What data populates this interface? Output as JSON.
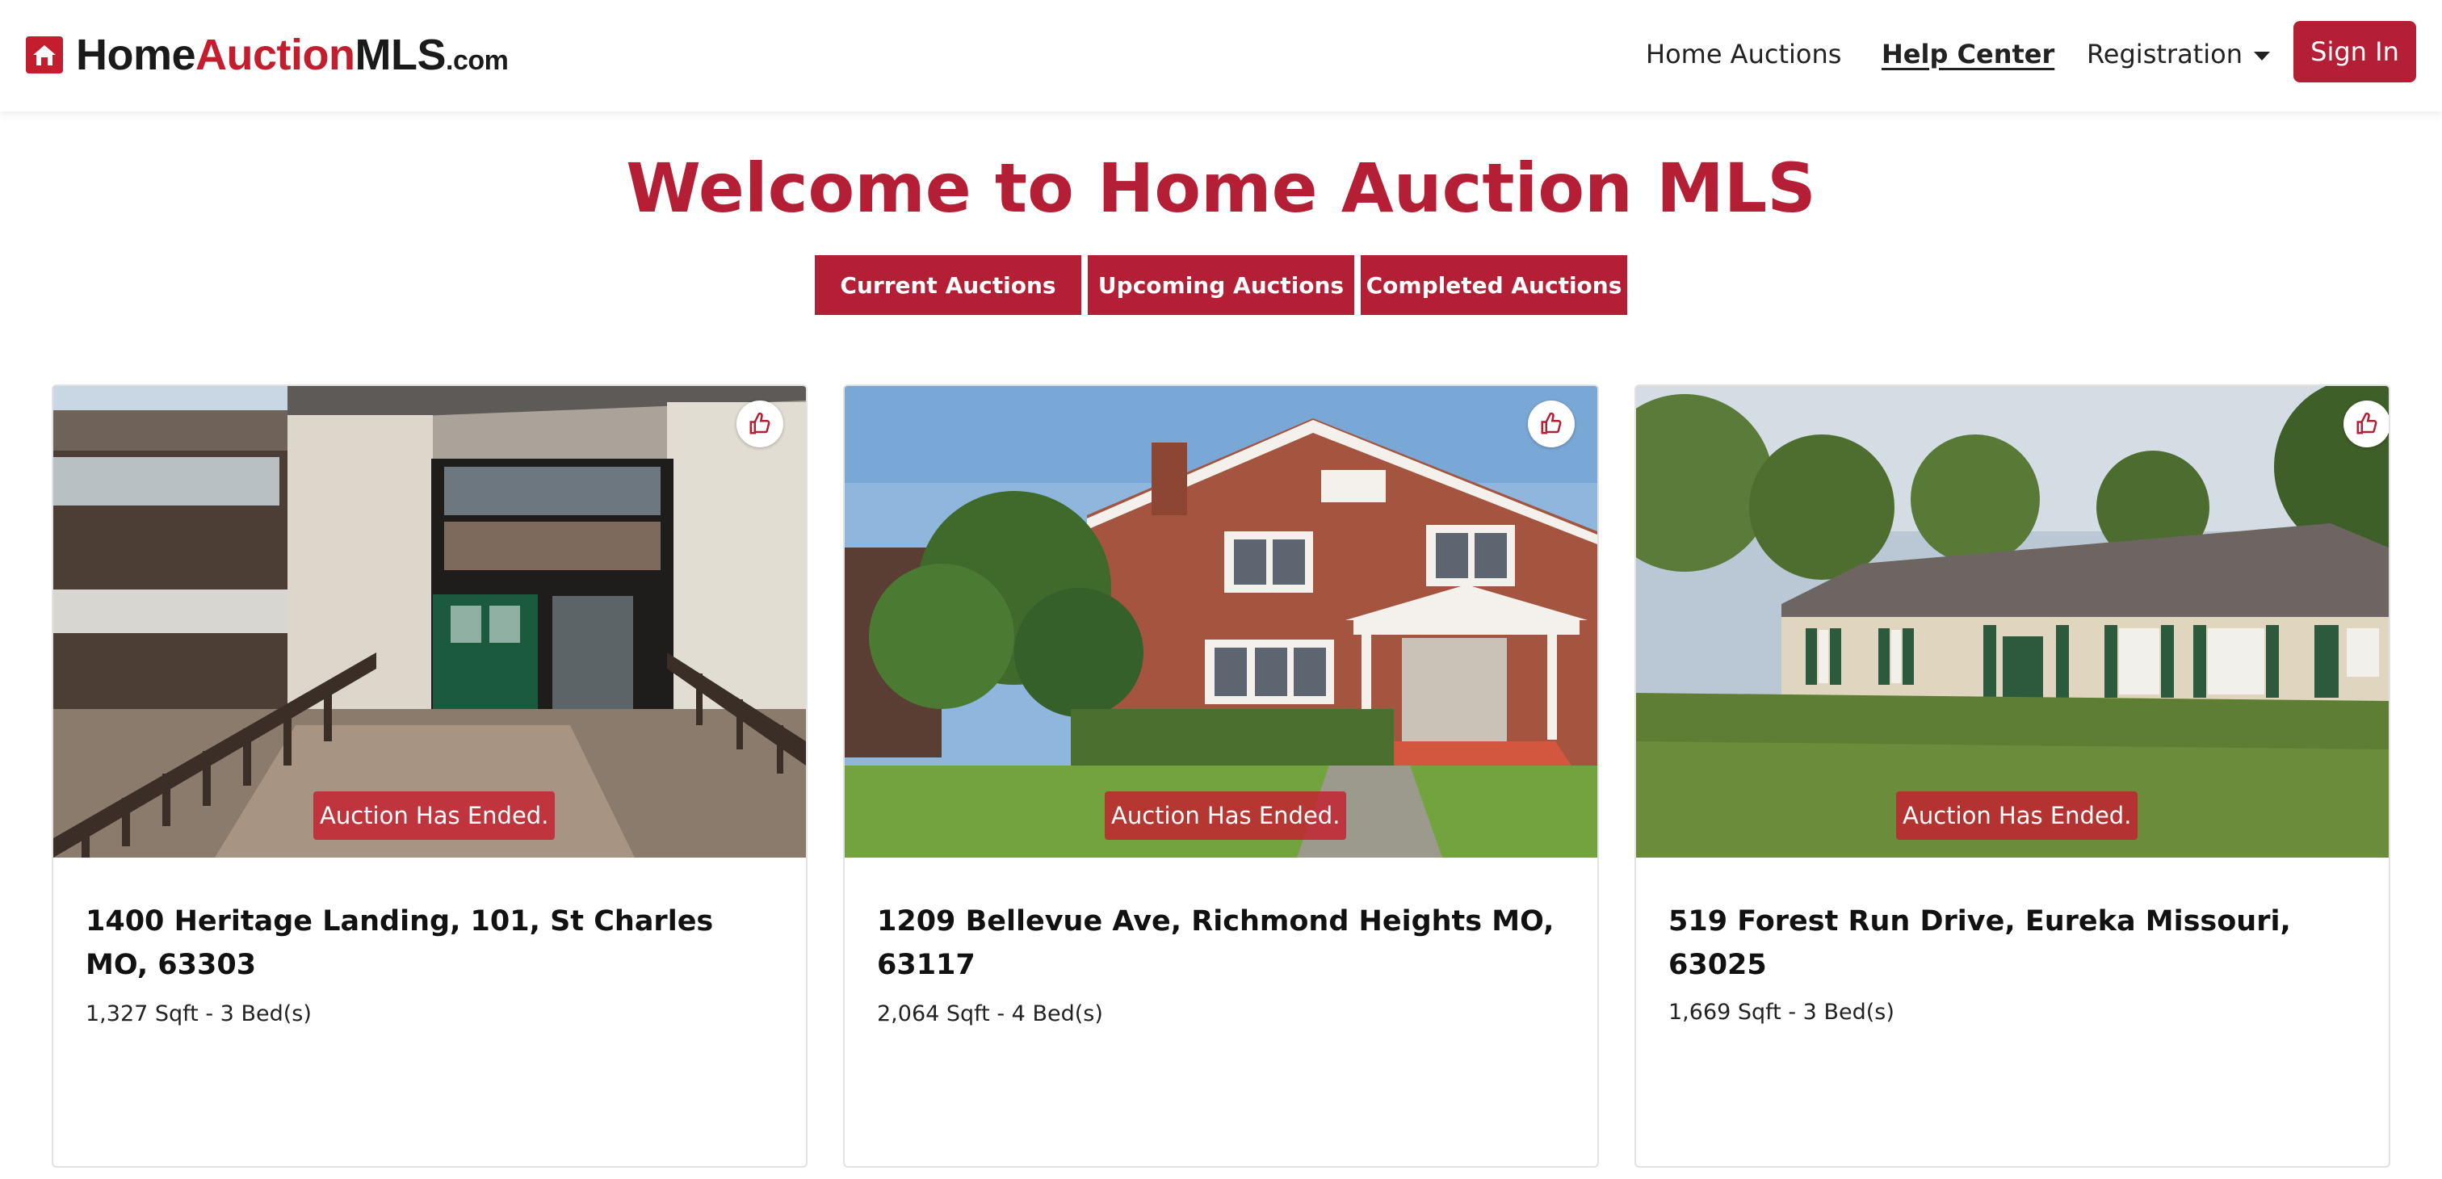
{
  "header": {
    "logo": {
      "part1": "Home",
      "part2": "Auction",
      "part3": "MLS",
      "part4": ".com",
      "icon": "home-logo-icon"
    },
    "nav": {
      "home_auctions": "Home Auctions",
      "help_center": "Help Center",
      "registration": "Registration",
      "sign_in": "Sign In"
    }
  },
  "main": {
    "title": "Welcome to Home Auction MLS",
    "tabs": [
      {
        "label": "Current Auctions"
      },
      {
        "label": "Upcoming Auctions"
      },
      {
        "label": "Completed Auctions"
      }
    ]
  },
  "listings": [
    {
      "address": "1400 Heritage Landing, 101, St Charles MO, 63303",
      "details": "1,327 Sqft - 3 Bed(s)",
      "status": "Auction Has Ended.",
      "photo": "condo-entrance-photo"
    },
    {
      "address": "1209 Bellevue Ave, Richmond Heights MO, 63117",
      "details": "2,064 Sqft - 4 Bed(s)",
      "status": "Auction Has Ended.",
      "photo": "brick-house-photo"
    },
    {
      "address": "519 Forest Run Drive, Eureka Missouri, 63025",
      "details": "1,669 Sqft - 3 Bed(s)",
      "status": "Auction Has Ended.",
      "photo": "ranch-house-photo"
    }
  ],
  "colors": {
    "brand": "#b51f35",
    "logo_red": "#c41e2e",
    "text": "#1a1a1a"
  }
}
